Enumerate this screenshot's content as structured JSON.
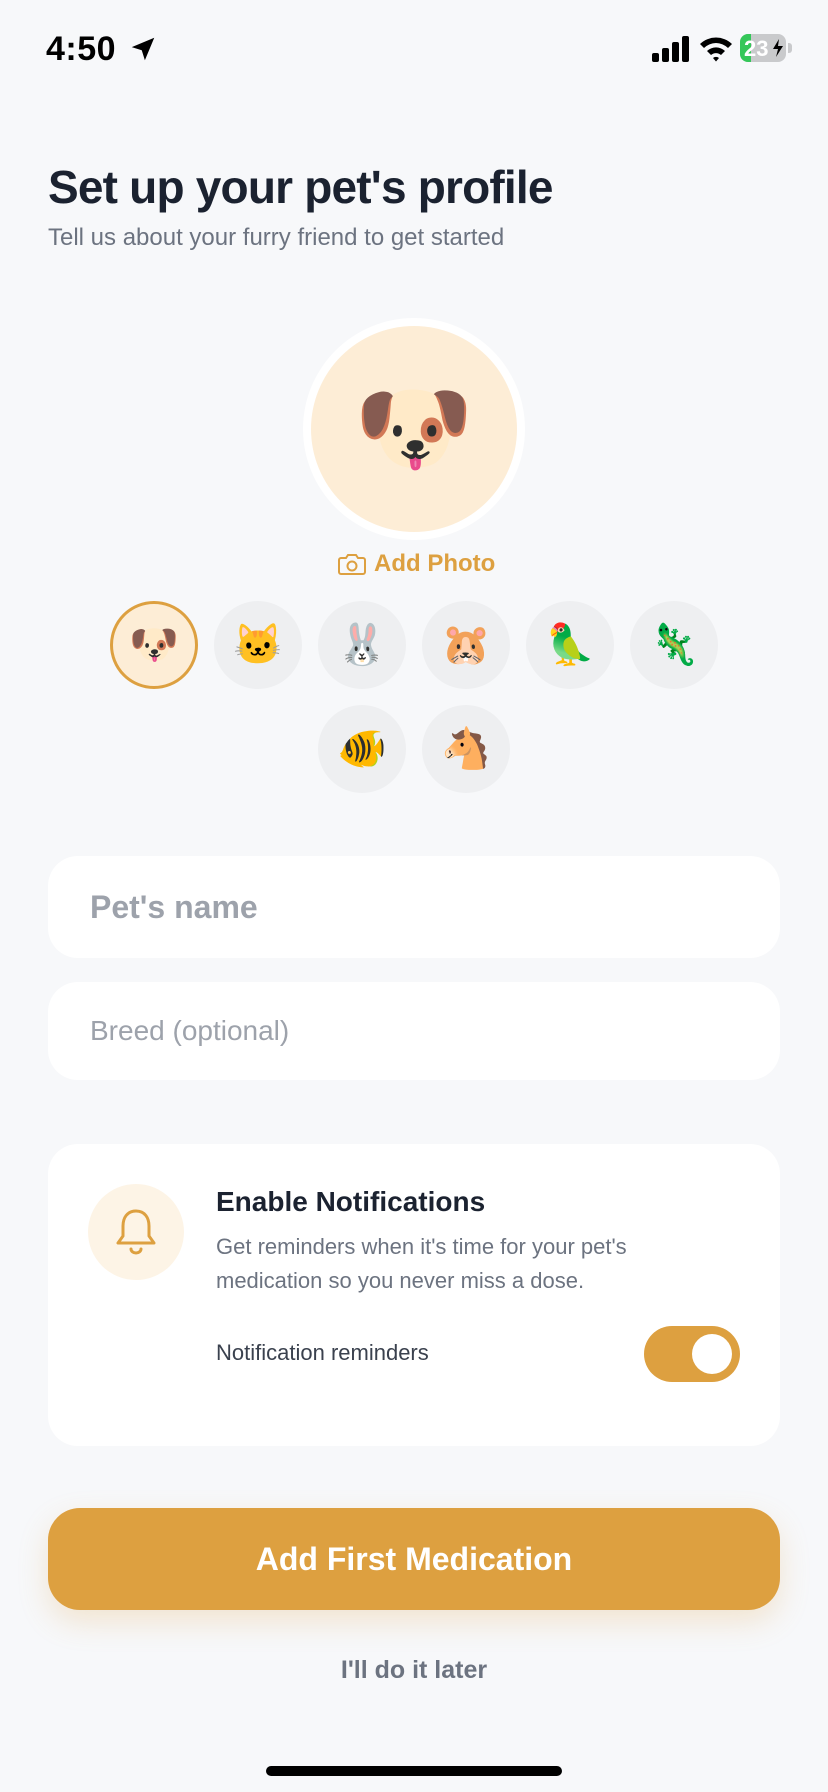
{
  "status_bar": {
    "time": "4:50",
    "battery_level": "23",
    "battery_fraction": 0.23,
    "icons": [
      "location-arrow-icon",
      "cellular-signal-icon",
      "wifi-icon",
      "battery-charging-icon"
    ]
  },
  "header": {
    "title": "Set up your pet's profile",
    "subtitle": "Tell us about your furry friend to get started"
  },
  "avatar": {
    "emoji": "🐶",
    "add_photo_label": "Add Photo",
    "add_photo_icon": "camera-icon"
  },
  "pet_types": [
    {
      "emoji": "🐶",
      "name": "dog",
      "selected": true
    },
    {
      "emoji": "🐱",
      "name": "cat",
      "selected": false
    },
    {
      "emoji": "🐰",
      "name": "rabbit",
      "selected": false
    },
    {
      "emoji": "🐹",
      "name": "hamster",
      "selected": false
    },
    {
      "emoji": "🦜",
      "name": "parrot",
      "selected": false
    },
    {
      "emoji": "🦎",
      "name": "lizard",
      "selected": false
    },
    {
      "emoji": "🐠",
      "name": "fish",
      "selected": false
    },
    {
      "emoji": "🐴",
      "name": "horse",
      "selected": false
    }
  ],
  "form": {
    "name_placeholder": "Pet's name",
    "name_value": "",
    "breed_placeholder": "Breed (optional)",
    "breed_value": ""
  },
  "notifications": {
    "icon": "bell-icon",
    "title": "Enable Notifications",
    "description": "Get reminders when it's time for your pet's medication so you never miss a dose.",
    "toggle_label": "Notification reminders",
    "enabled": true
  },
  "actions": {
    "primary_label": "Add First Medication",
    "secondary_label": "I'll do it later"
  },
  "colors": {
    "accent": "#dda040",
    "accent_light": "#fdedd6",
    "background": "#f7f8fa",
    "text_primary": "#1b2230",
    "text_secondary": "#6c7380"
  }
}
